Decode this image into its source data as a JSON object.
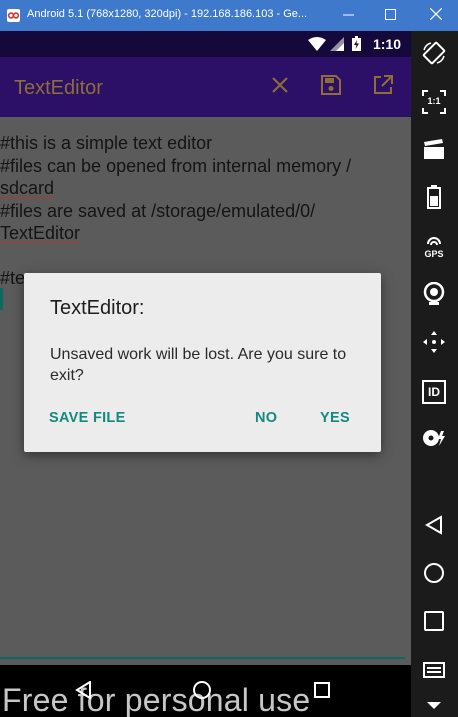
{
  "window": {
    "title": "Android 5.1 (768x1280, 320dpi) - 192.168.186.103 - Ge...",
    "buttons": {
      "minimize": "minimize-icon",
      "maximize": "maximize-icon",
      "close": "close-icon"
    }
  },
  "statusbar": {
    "time": "1:10",
    "icons": [
      "wifi-icon",
      "signal-icon",
      "battery-icon"
    ]
  },
  "appbar": {
    "title": "TextEditor",
    "actions": [
      "close-icon",
      "save-icon",
      "open-external-icon"
    ],
    "accent_color": "#8e6d38"
  },
  "editor": {
    "lines": [
      {
        "text": "#this is a simple text editor"
      },
      {
        "text": "#files can be opened from internal memory /"
      },
      {
        "text": "sdcard",
        "misspelled": true
      },
      {
        "text": "#files are saved at /storage/emulated/0/"
      },
      {
        "text": "TextEditor",
        "misspelled": true
      },
      {
        "text": ""
      },
      {
        "text": "#te..."
      }
    ],
    "line_visible_prefix": "#te"
  },
  "dialog": {
    "title": "TextEditor:",
    "message": "Unsaved work will be lost. Are you sure to exit?",
    "buttons": {
      "save": "SAVE FILE",
      "no": "NO",
      "yes": "YES"
    },
    "button_color": "#14897f"
  },
  "navbar": {
    "buttons": [
      "back-icon",
      "home-icon",
      "recents-icon"
    ]
  },
  "watermark": {
    "text": "Free for personal use"
  },
  "sidebar": {
    "tools": [
      "rotate-icon",
      "pixel-perfect-icon",
      "camera-icon",
      "battery-tool-icon",
      "gps-icon",
      "webcam-icon",
      "dpad-icon",
      "device-id-icon",
      "disk-icon",
      "back-icon",
      "home-icon",
      "recents-icon",
      "menu-icon",
      "more-icon"
    ],
    "labels": {
      "pixel": "1:1",
      "gps": "GPS",
      "id": "ID"
    }
  }
}
